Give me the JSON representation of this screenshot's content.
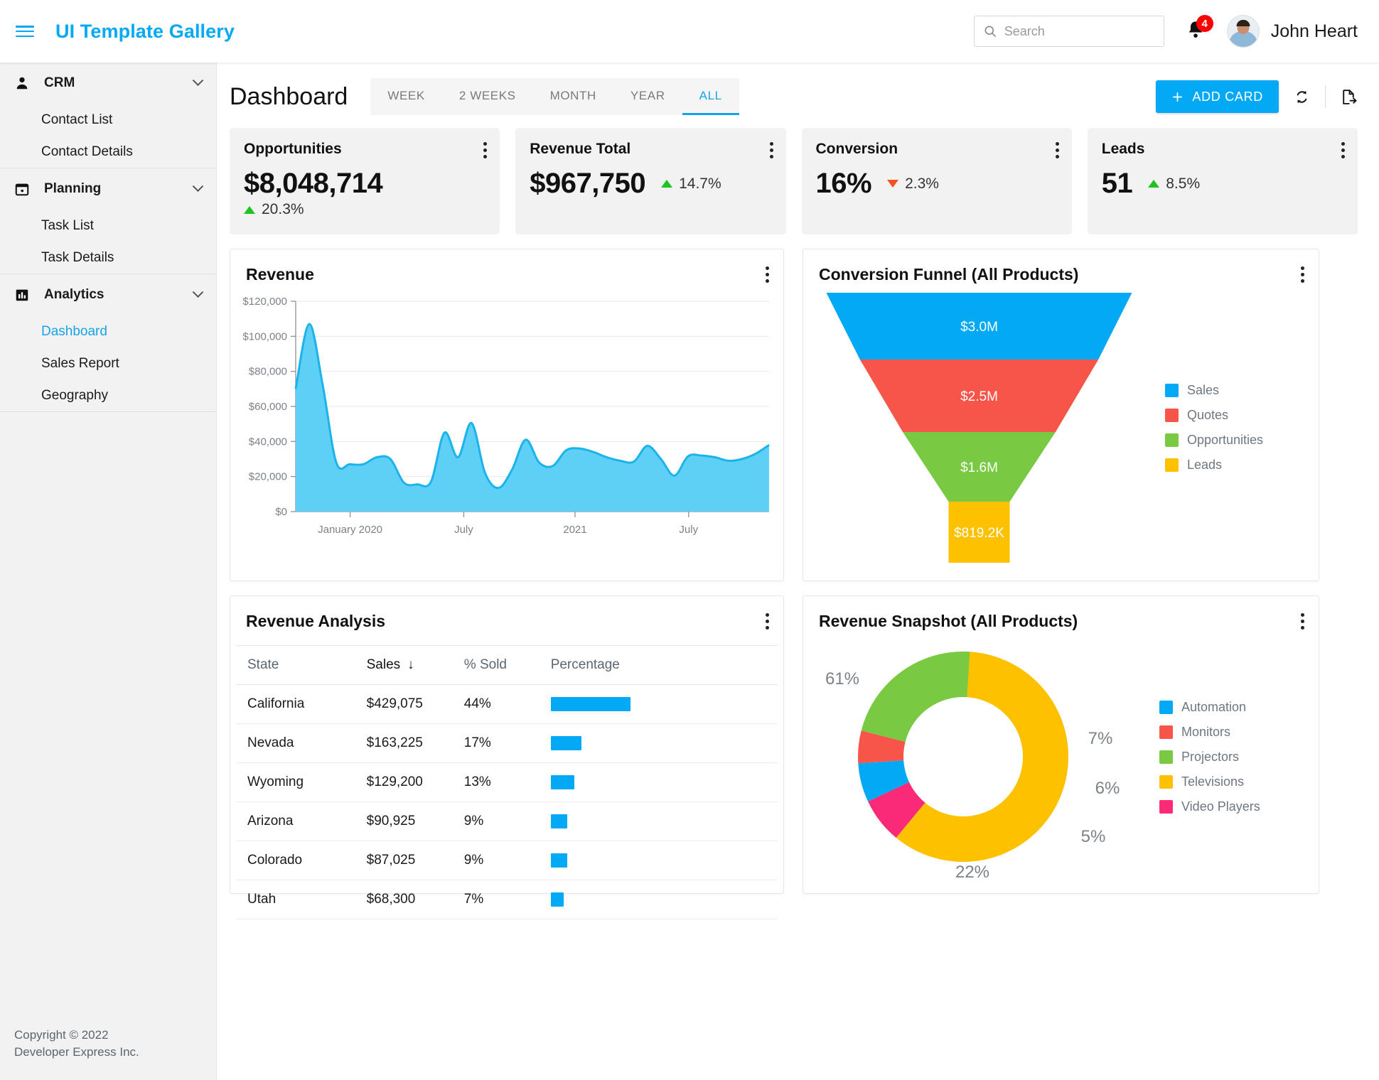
{
  "header": {
    "brand": "UI Template Gallery",
    "menu_icon": "hamburger-icon",
    "search": {
      "placeholder": "Search",
      "value": "",
      "icon": "search-icon"
    },
    "notifications": {
      "icon": "bell-icon",
      "count": "4"
    },
    "user": {
      "name": "John Heart",
      "avatar": "user-avatar"
    }
  },
  "sidebar": {
    "groups": [
      {
        "label": "CRM",
        "icon": "person-icon",
        "chevron": "chevron-down-icon",
        "items": [
          {
            "label": "Contact List",
            "active": false
          },
          {
            "label": "Contact Details",
            "active": false
          }
        ]
      },
      {
        "label": "Planning",
        "icon": "calendar-icon",
        "chevron": "chevron-down-icon",
        "items": [
          {
            "label": "Task List",
            "active": false
          },
          {
            "label": "Task Details",
            "active": false
          }
        ]
      },
      {
        "label": "Analytics",
        "icon": "bar-chart-icon",
        "chevron": "chevron-down-icon",
        "items": [
          {
            "label": "Dashboard",
            "active": true
          },
          {
            "label": "Sales Report",
            "active": false
          },
          {
            "label": "Geography",
            "active": false
          }
        ]
      }
    ],
    "copyright_line1": "Copyright © 2022",
    "copyright_line2": "Developer Express Inc."
  },
  "page": {
    "title": "Dashboard",
    "tabs": [
      {
        "label": "WEEK",
        "active": false
      },
      {
        "label": "2 WEEKS",
        "active": false
      },
      {
        "label": "MONTH",
        "active": false
      },
      {
        "label": "YEAR",
        "active": false
      },
      {
        "label": "ALL",
        "active": true
      }
    ],
    "add_card_label": "ADD CARD",
    "refresh_icon": "refresh-icon",
    "export_icon": "export-file-icon",
    "menu_icon": "more-vertical-icon"
  },
  "kpis": [
    {
      "title": "Opportunities",
      "value": "$8,048,714",
      "delta": "20.3%",
      "direction": "up",
      "wrap": true
    },
    {
      "title": "Revenue Total",
      "value": "$967,750",
      "delta": "14.7%",
      "direction": "up",
      "wrap": false
    },
    {
      "title": "Conversion",
      "value": "16%",
      "delta": "2.3%",
      "direction": "down",
      "wrap": false
    },
    {
      "title": "Leads",
      "value": "51",
      "delta": "8.5%",
      "direction": "up",
      "wrap": false
    }
  ],
  "panels": {
    "revenue": {
      "title": "Revenue"
    },
    "funnel": {
      "title": "Conversion Funnel (All Products)"
    },
    "analysis": {
      "title": "Revenue Analysis"
    },
    "snapshot": {
      "title": "Revenue Snapshot (All Products)"
    }
  },
  "colors": {
    "accent": "#03a9f4",
    "area_fill": "#5ed0f5",
    "area_line": "#1cb3ea",
    "blue": "#03a9f4",
    "red": "#f75549",
    "green": "#7ac943",
    "yellow": "#fdc100",
    "pink": "#fa2a78",
    "up": "#1ec31e",
    "down": "#f4511e"
  },
  "chart_data": [
    {
      "type": "area",
      "title": "Revenue",
      "xlabel": "",
      "ylabel": "",
      "ylim": [
        0,
        120000
      ],
      "ytick_labels": [
        "$0",
        "$20,000",
        "$40,000",
        "$60,000",
        "$80,000",
        "$100,000",
        "$120,000"
      ],
      "ytick_values": [
        0,
        20000,
        40000,
        60000,
        80000,
        100000,
        120000
      ],
      "xtick_labels": [
        "January 2020",
        "July",
        "2021",
        "July"
      ],
      "grid": true,
      "legend": "none",
      "series": [
        {
          "name": "Revenue",
          "values": [
            70000,
            107000,
            72000,
            28000,
            27000,
            27000,
            31000,
            30000,
            16500,
            15500,
            17000,
            45000,
            31000,
            50500,
            22000,
            13500,
            24000,
            41000,
            28000,
            26000,
            35000,
            36000,
            34000,
            31000,
            29000,
            28500,
            37500,
            30000,
            20500,
            31500,
            32000,
            31000,
            29000,
            30000,
            33000,
            38000
          ]
        }
      ]
    },
    {
      "type": "funnel",
      "title": "Conversion Funnel (All Products)",
      "legend": "right",
      "categories": [
        "Sales",
        "Quotes",
        "Opportunities",
        "Leads"
      ],
      "labels": [
        "$3.0M",
        "$2.5M",
        "$1.6M",
        "$819.2K"
      ],
      "values": [
        3000000,
        2500000,
        1600000,
        819200
      ],
      "colors": [
        "#03a9f4",
        "#f75549",
        "#7ac943",
        "#fdc100"
      ]
    },
    {
      "type": "table",
      "title": "Revenue Analysis",
      "columns": [
        "State",
        "Sales",
        "% Sold",
        "Percentage"
      ],
      "sort_column": "Sales",
      "sort_direction": "desc",
      "sort_icon": "arrow-down-icon",
      "rows": [
        {
          "state": "California",
          "sales": "$429,075",
          "pct_sold": "44%",
          "bar_pct": 44
        },
        {
          "state": "Nevada",
          "sales": "$163,225",
          "pct_sold": "17%",
          "bar_pct": 17
        },
        {
          "state": "Wyoming",
          "sales": "$129,200",
          "pct_sold": "13%",
          "bar_pct": 13
        },
        {
          "state": "Arizona",
          "sales": "$90,925",
          "pct_sold": "9%",
          "bar_pct": 9
        },
        {
          "state": "Colorado",
          "sales": "$87,025",
          "pct_sold": "9%",
          "bar_pct": 9
        },
        {
          "state": "Utah",
          "sales": "$68,300",
          "pct_sold": "7%",
          "bar_pct": 7
        }
      ]
    },
    {
      "type": "pie",
      "title": "Revenue Snapshot (All Products)",
      "donut": true,
      "legend": "right",
      "categories": [
        "Automation",
        "Monitors",
        "Projectors",
        "Televisions",
        "Video Players"
      ],
      "values": [
        6,
        5,
        22,
        61,
        7
      ],
      "labels": [
        "6%",
        "5%",
        "22%",
        "61%",
        "7%"
      ],
      "colors": [
        "#03a9f4",
        "#f75549",
        "#7ac943",
        "#fdc100",
        "#fa2a78"
      ]
    }
  ]
}
